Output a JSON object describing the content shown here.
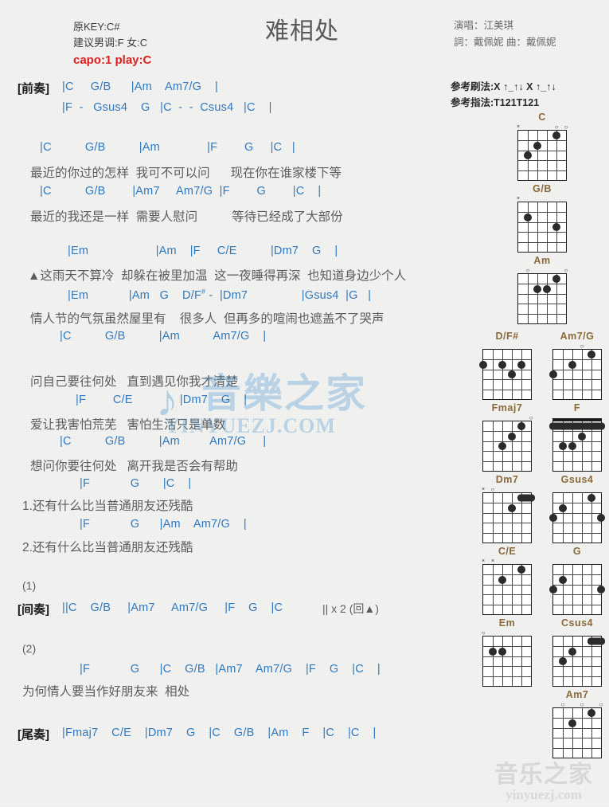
{
  "header": {
    "title": "难相处",
    "key_original": "原KEY:C#",
    "key_suggest": "建议男调:F 女:C",
    "capo": "capo:1 play:C",
    "singer": "演唱：江美琪",
    "writer": "詞：戴佩妮  曲：戴佩妮",
    "strum_pattern": "参考刷法:X ↑_↑↓ X ↑_↑↓",
    "finger_pattern": "参考指法:T121T121"
  },
  "sections": {
    "intro_label": "[前奏]",
    "interlude_label": "[间奏]",
    "outro_label": "[尾奏]",
    "mark_1": "(1)",
    "mark_2": "(2)",
    "interlude_repeat": "|| x 2 (回▲)"
  },
  "lines": [
    {
      "id": "intro1",
      "type": "chord",
      "text": "|C     G/B      |Am    Am7/G    |"
    },
    {
      "id": "intro2",
      "type": "chord",
      "text": "|F  -   Gsus4    G   |C  -  -  Csus4   |C    |"
    },
    {
      "id": "v1c1",
      "type": "chord",
      "text": "|C          G/B          |Am              |F        G     |C   |"
    },
    {
      "id": "v1l1",
      "type": "lyric",
      "text": "最近的你过的怎样  我可不可以问      现在你在谁家楼下等"
    },
    {
      "id": "v1c2",
      "type": "chord",
      "text": "|C          G/B        |Am7     Am7/G  |F        G        |C    |"
    },
    {
      "id": "v1l2",
      "type": "lyric",
      "text": "最近的我还是一样  需要人慰问          等待已经成了大部份"
    },
    {
      "id": "v2c1",
      "type": "chord",
      "text": "|Em                    |Am    |F     C/E          |Dm7    G    |"
    },
    {
      "id": "v2l1",
      "type": "lyric",
      "text": "▲这雨天不算冷  却躲在被里加温  这一夜睡得再深  也知道身边少个人"
    },
    {
      "id": "v2c2",
      "type": "chord",
      "text": "|Em            |Am   G    D/F# -  |Dm7                |Gsus4  |G   |"
    },
    {
      "id": "v2l2",
      "type": "lyric",
      "text": "情人节的气氛虽然屋里有    很多人  但再多的喧闹也遮盖不了哭声"
    },
    {
      "id": "c1c1",
      "type": "chord",
      "text": "|C          G/B          |Am          Am7/G    |"
    },
    {
      "id": "c1l1",
      "type": "lyric",
      "text": "问自己要往何处   直到遇见你我才清楚"
    },
    {
      "id": "c1c2",
      "type": "chord",
      "text": "|F        C/E              |Dm7    G    |"
    },
    {
      "id": "c1l2",
      "type": "lyric",
      "text": "爱让我害怕荒芜   害怕生活只是单数"
    },
    {
      "id": "c1c3",
      "type": "chord",
      "text": "|C          G/B          |Am         Am7/G     |"
    },
    {
      "id": "c1l3",
      "type": "lyric",
      "text": "想问你要往何处   离开我是否会有帮助"
    },
    {
      "id": "e1c",
      "type": "chord",
      "text": "|F            G       |C    |"
    },
    {
      "id": "e1l",
      "type": "lyric",
      "text": "1.还有什么比当普通朋友还残酷"
    },
    {
      "id": "e2c",
      "type": "chord",
      "text": "|F            G      |Am    Am7/G    |"
    },
    {
      "id": "e2l",
      "type": "lyric",
      "text": "2.还有什么比当普通朋友还残酷"
    },
    {
      "id": "intl",
      "type": "chord",
      "text": "||C    G/B     |Am7     Am7/G     |F    G    |C    "
    },
    {
      "id": "s2c",
      "type": "chord",
      "text": "|F            G      |C    G/B   |Am7    Am7/G    |F    G    |C    |"
    },
    {
      "id": "s2l",
      "type": "lyric",
      "text": "为何情人要当作好朋友来  相处"
    },
    {
      "id": "outc",
      "type": "chord",
      "text": "|Fmaj7    C/E    |Dm7    G    |C    G/B    |Am    F    |C    |C    |"
    }
  ],
  "chord_diagrams": [
    {
      "name": "C",
      "markers": "x..oo",
      "dots": "C"
    },
    {
      "name": "G/B",
      "markers": "x",
      "dots": "GB"
    },
    {
      "name": "Am",
      "markers": "o..o",
      "dots": "Am"
    },
    {
      "name": "D/F#",
      "markers": "",
      "dots": "DFs"
    },
    {
      "name": "Am7/G",
      "markers": "o",
      "dots": "Am7G"
    },
    {
      "name": "Fmaj7",
      "markers": "o",
      "dots": "Fmaj7"
    },
    {
      "name": "F",
      "markers": "",
      "dots": "F"
    },
    {
      "name": "Dm7",
      "markers": "xo",
      "dots": "Dm7"
    },
    {
      "name": "Gsus4",
      "markers": "",
      "dots": "Gsus4"
    },
    {
      "name": "C/E",
      "markers": "xx",
      "dots": "CE"
    },
    {
      "name": "G",
      "markers": "",
      "dots": "G"
    },
    {
      "name": "Em",
      "markers": "o",
      "dots": "Em"
    },
    {
      "name": "Csus4",
      "markers": "",
      "dots": "Csus4"
    },
    {
      "name": "Am7",
      "markers": "ooo",
      "dots": "Am7"
    }
  ],
  "watermark": {
    "center_cn": "音樂之家",
    "center_en": "YINYUEZJ.COM",
    "bottom_cn": "音乐之家",
    "bottom_en": "yinyuezj.com"
  },
  "colors": {
    "chord": "#2f79c0",
    "lyric": "#5c5c5c",
    "accent_red": "#e02020",
    "chord_name": "#8a6a3a"
  }
}
